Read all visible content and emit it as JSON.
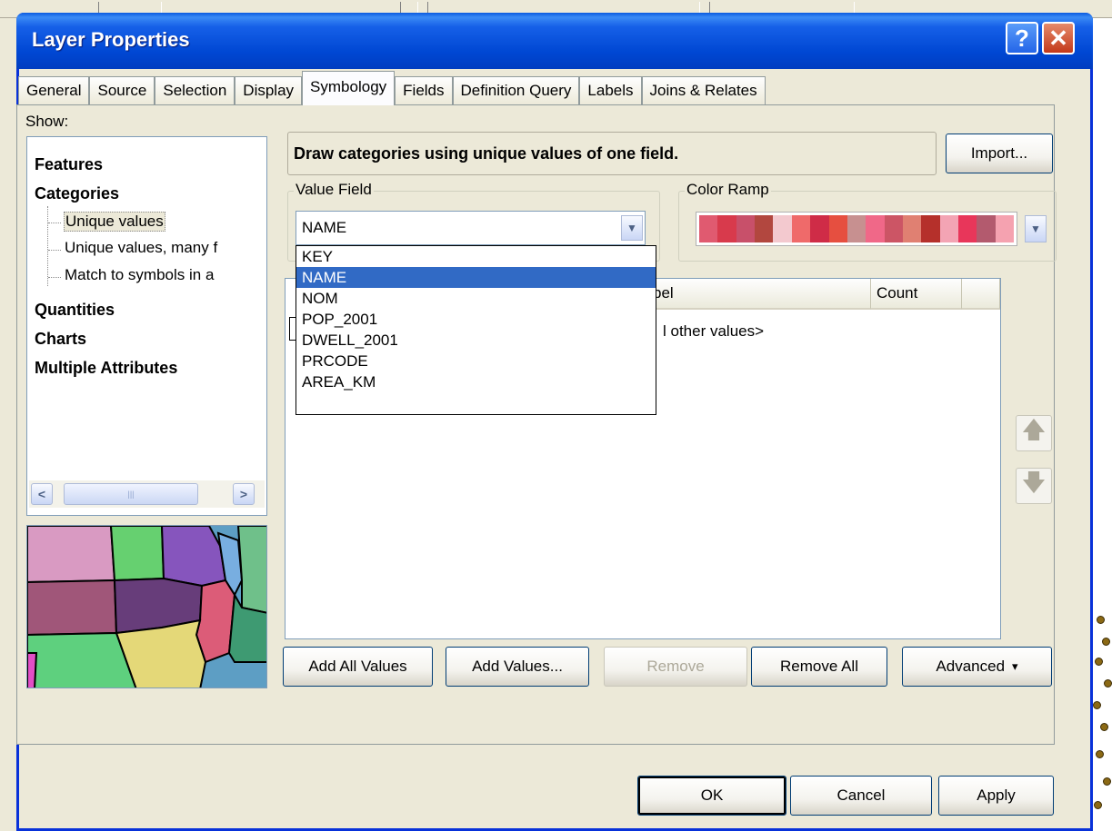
{
  "window": {
    "title": "Layer Properties",
    "help_glyph": "?",
    "close_glyph": "✕"
  },
  "tabs": [
    {
      "label": "General"
    },
    {
      "label": "Source"
    },
    {
      "label": "Selection"
    },
    {
      "label": "Display"
    },
    {
      "label": "Symbology"
    },
    {
      "label": "Fields"
    },
    {
      "label": "Definition Query"
    },
    {
      "label": "Labels"
    },
    {
      "label": "Joins & Relates"
    }
  ],
  "active_tab": "Symbology",
  "show": {
    "label": "Show:",
    "items": [
      {
        "label": "Features"
      },
      {
        "label": "Categories"
      },
      {
        "label": "Unique values"
      },
      {
        "label": "Unique values, many f"
      },
      {
        "label": "Match to symbols in a"
      },
      {
        "label": "Quantities"
      },
      {
        "label": "Charts"
      },
      {
        "label": "Multiple Attributes"
      }
    ]
  },
  "description": "Draw categories using unique values of one field.",
  "buttons": {
    "import": "Import...",
    "add_all": "Add All Values",
    "add_values": "Add Values...",
    "remove": "Remove",
    "remove_all": "Remove All",
    "advanced": "Advanced",
    "advanced_arrow": "▾",
    "ok": "OK",
    "cancel": "Cancel",
    "apply": "Apply"
  },
  "value_field": {
    "label": "Value Field",
    "selected": "NAME",
    "options": [
      "KEY",
      "NAME",
      "NOM",
      "POP_2001",
      "DWELL_2001",
      "PRCODE",
      "AREA_KM"
    ]
  },
  "color_ramp": {
    "label": "Color Ramp",
    "colors": [
      "#e05a70",
      "#d83a4c",
      "#c8506a",
      "#b2473f",
      "#f3c9cf",
      "#ef6a6a",
      "#cf2c47",
      "#e64f40",
      "#c79090",
      "#f06888",
      "#cc5565",
      "#e08072",
      "#b5302b",
      "#f3a4b4",
      "#e8365a",
      "#b35a6e",
      "#f5a2b0"
    ]
  },
  "list": {
    "headers": [
      "bel",
      "Count"
    ],
    "rows": [
      {
        "label": "l other values>"
      }
    ]
  },
  "colors": {
    "accent": "#316ac5",
    "titlebar": "#0047d3",
    "face": "#ece9d8"
  }
}
